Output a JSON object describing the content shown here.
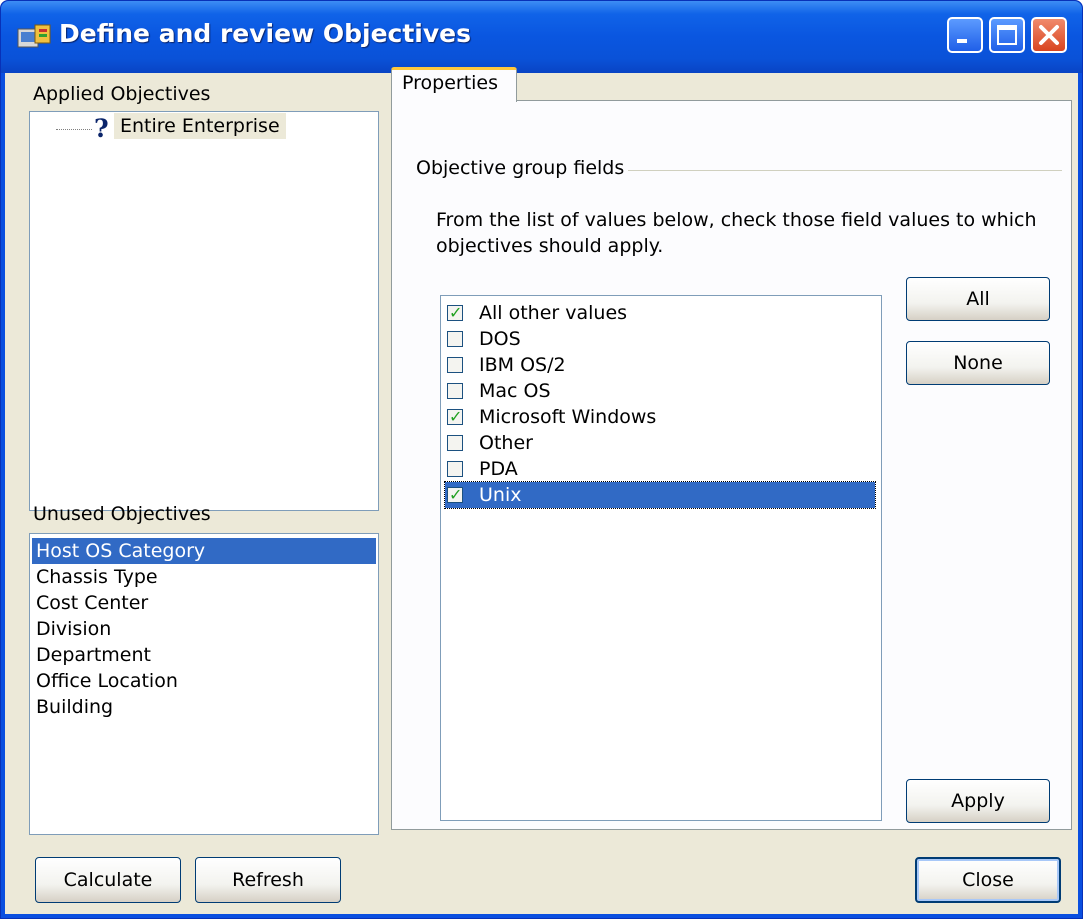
{
  "window": {
    "title": "Define and review Objectives",
    "controls": [
      "minimize-icon",
      "maximize-icon",
      "close-icon"
    ]
  },
  "left": {
    "applied_label": "Applied Objectives",
    "applied_tree": {
      "icon": "question-icon",
      "label": "Entire Enterprise"
    },
    "unused_label": "Unused Objectives",
    "unused_items": [
      "Host OS Category",
      "Chassis Type",
      "Cost Center",
      "Division",
      "Department",
      "Office Location",
      "Building"
    ],
    "unused_selected": "Host OS Category"
  },
  "tabs": [
    {
      "label": "Properties",
      "active": true
    }
  ],
  "properties": {
    "group_label": "Objective group fields",
    "instruction_line1": "From the list of values below, check those field values to which",
    "instruction_line2": "objectives should apply.",
    "values": [
      {
        "label": "All other values",
        "checked": true
      },
      {
        "label": "DOS",
        "checked": false
      },
      {
        "label": "IBM OS/2",
        "checked": false
      },
      {
        "label": "Mac OS",
        "checked": false
      },
      {
        "label": "Microsoft Windows",
        "checked": true
      },
      {
        "label": "Other",
        "checked": false
      },
      {
        "label": "PDA",
        "checked": false
      },
      {
        "label": "Unix",
        "checked": true
      }
    ],
    "selected_value": "Unix",
    "all_button": "All",
    "none_button": "None",
    "apply_button": "Apply"
  },
  "footer": {
    "calculate_button": "Calculate",
    "refresh_button": "Refresh",
    "close_button": "Close"
  },
  "colors": {
    "titlebar": "#0a56e0",
    "selection": "#316ac5",
    "dialog_face": "#ece9d8",
    "tab_highlight": "#ffc83c",
    "check_green": "#21a121"
  }
}
